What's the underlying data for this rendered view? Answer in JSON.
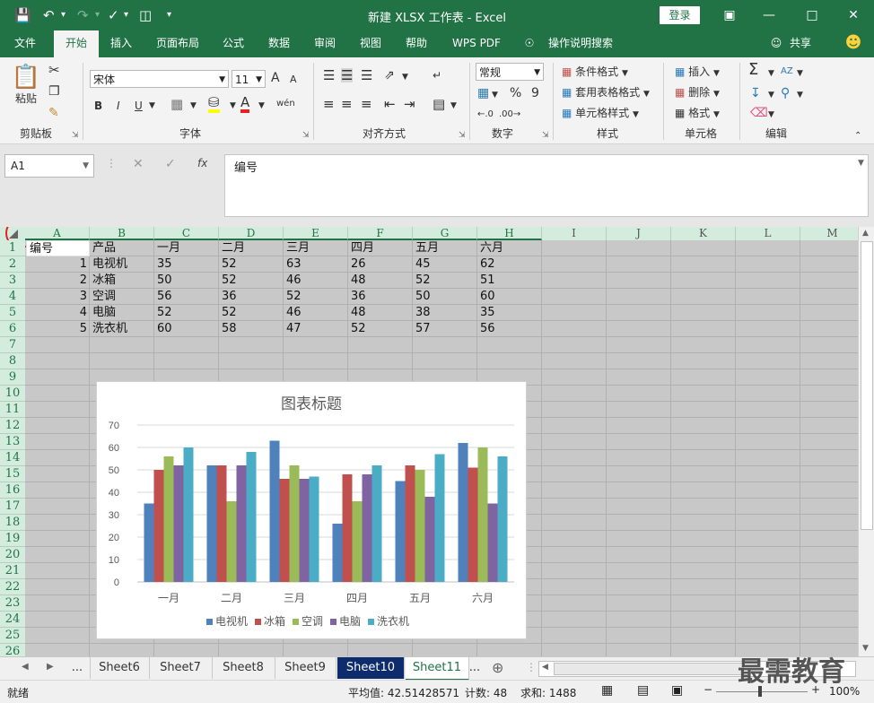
{
  "title_bar": {
    "title": "新建 XLSX 工作表  -  Excel",
    "login": "登录"
  },
  "tabs": [
    "文件",
    "开始",
    "插入",
    "页面布局",
    "公式",
    "数据",
    "审阅",
    "视图",
    "帮助",
    "WPS PDF",
    "操作说明搜索",
    "共享"
  ],
  "ribbon": {
    "clipboard": {
      "paste": "粘贴",
      "label": "剪贴板"
    },
    "font": {
      "name": "宋体",
      "size": "11",
      "label": "字体",
      "bold": "B",
      "italic": "I",
      "underline": "U",
      "grow": "A",
      "shrink": "A",
      "color_letter": "A",
      "phonetic": "wén"
    },
    "alignment": {
      "label": "对齐方式"
    },
    "number": {
      "format": "常规",
      "label": "数字",
      "percent": "%",
      "comma": "9"
    },
    "styles": {
      "conditional": "条件格式",
      "table": "套用表格格式",
      "cell": "单元格样式",
      "label": "样式"
    },
    "cells": {
      "insert": "插入",
      "delete": "删除",
      "format": "格式",
      "label": "单元格"
    },
    "editing": {
      "label": "编辑",
      "sum": "Σ",
      "sort": "AZ"
    }
  },
  "formula_bar": {
    "name_box": "A1",
    "fx": "fx",
    "content": "编号"
  },
  "columns": [
    "A",
    "B",
    "C",
    "D",
    "E",
    "F",
    "G",
    "H",
    "I",
    "J",
    "K",
    "L",
    "M"
  ],
  "rows": [
    "1",
    "2",
    "3",
    "4",
    "5",
    "6",
    "7",
    "8",
    "9",
    "10",
    "11",
    "12",
    "13",
    "14",
    "15",
    "16",
    "17",
    "18",
    "19",
    "20",
    "21",
    "22",
    "23",
    "24",
    "25",
    "26"
  ],
  "table": {
    "header": [
      "编号",
      "产品",
      "一月",
      "二月",
      "三月",
      "四月",
      "五月",
      "六月"
    ],
    "rows": [
      [
        "1",
        "电视机",
        "35",
        "52",
        "63",
        "26",
        "45",
        "62"
      ],
      [
        "2",
        "冰箱",
        "50",
        "52",
        "46",
        "48",
        "52",
        "51"
      ],
      [
        "3",
        "空调",
        "56",
        "36",
        "52",
        "36",
        "50",
        "60"
      ],
      [
        "4",
        "电脑",
        "52",
        "52",
        "46",
        "48",
        "38",
        "35"
      ],
      [
        "5",
        "洗衣机",
        "60",
        "58",
        "47",
        "52",
        "57",
        "56"
      ]
    ]
  },
  "chart_data": {
    "type": "bar",
    "title": "图表标题",
    "categories": [
      "一月",
      "二月",
      "三月",
      "四月",
      "五月",
      "六月"
    ],
    "series": [
      {
        "name": "电视机",
        "values": [
          35,
          52,
          63,
          26,
          45,
          62
        ],
        "color": "#4f81bd"
      },
      {
        "name": "冰箱",
        "values": [
          50,
          52,
          46,
          48,
          52,
          51
        ],
        "color": "#c0504d"
      },
      {
        "name": "空调",
        "values": [
          56,
          36,
          52,
          36,
          50,
          60
        ],
        "color": "#9bbb59"
      },
      {
        "name": "电脑",
        "values": [
          52,
          52,
          46,
          48,
          38,
          35
        ],
        "color": "#8064a2"
      },
      {
        "name": "洗衣机",
        "values": [
          60,
          58,
          47,
          52,
          57,
          56
        ],
        "color": "#4bacc6"
      }
    ],
    "ylim": [
      0,
      70
    ],
    "yticks": [
      "0",
      "10",
      "20",
      "30",
      "40",
      "50",
      "60",
      "70"
    ],
    "grid": true,
    "legend": "bottom"
  },
  "sheets": [
    "...",
    "Sheet6",
    "Sheet7",
    "Sheet8",
    "Sheet9",
    "Sheet10",
    "Sheet11",
    "..."
  ],
  "status": {
    "mode": "就绪",
    "average": "平均值: 42.51428571",
    "count": "计数: 48",
    "sum": "求和: 1488",
    "zoom": "100%"
  },
  "watermark": "最需教育",
  "colors": {
    "accent": "#217346",
    "header_bg": "#d3ecdd",
    "selected_sheet": "#0d2c6e"
  }
}
